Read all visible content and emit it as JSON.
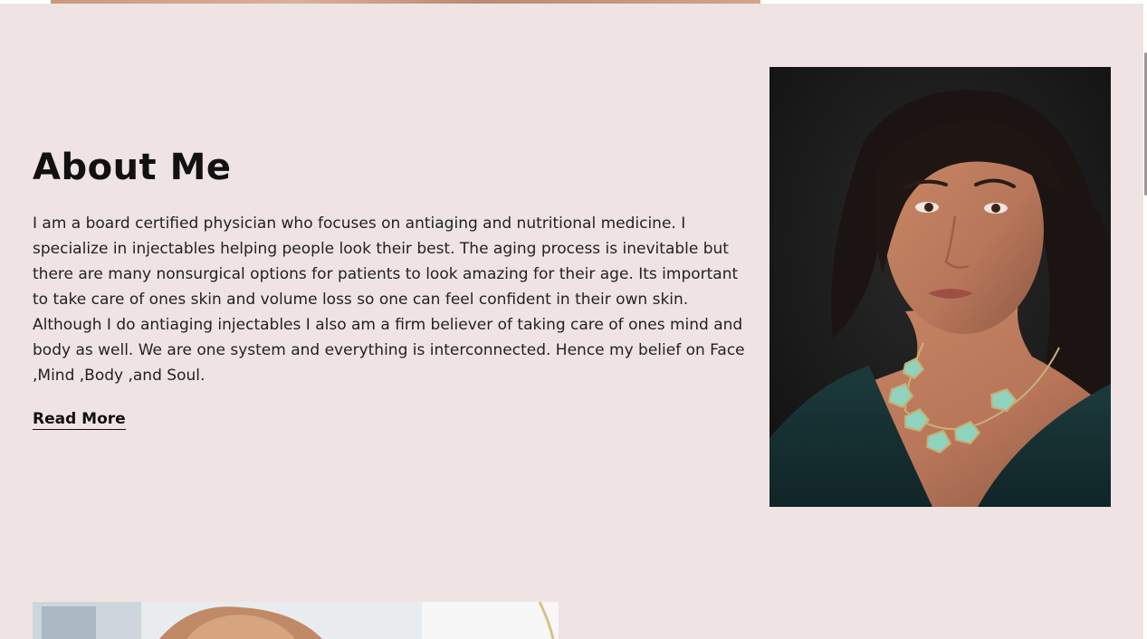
{
  "about": {
    "title": "About Me",
    "body": "I am a board certified physician who focuses on antiaging and nutritional medicine. I specialize in injectables helping people look their best. The aging process is inevitable but there are many nonsurgical options for patients to look amazing for their age. Its important to take care of ones skin and volume loss so one can feel confident in their own skin. Although I do antiaging injectables I also am a firm believer of taking care of ones mind and body as well. We are one system and everything is interconnected. Hence my belief on Face ,Mind ,Body ,and Soul.",
    "read_more_label": "Read More"
  },
  "colors": {
    "page_background": "#efe4e3",
    "text": "#1a1a1a",
    "portrait_background": "#151515"
  }
}
